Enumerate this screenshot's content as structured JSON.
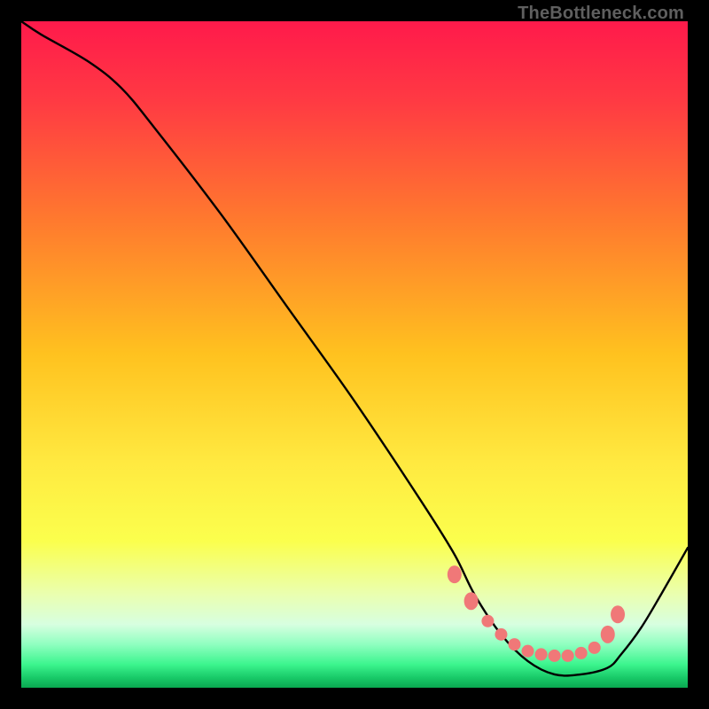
{
  "watermark": "TheBottleneck.com",
  "chart_data": {
    "type": "line",
    "xlim": [
      0,
      100
    ],
    "ylim": [
      0,
      100
    ],
    "xlabel": "",
    "ylabel": "",
    "title": "",
    "grid": false,
    "legend": false,
    "series": [
      {
        "name": "curve",
        "color": "#000000",
        "x": [
          0,
          3,
          10,
          15,
          20,
          30,
          40,
          50,
          60,
          65,
          68,
          72,
          76,
          80,
          84,
          88,
          90,
          93,
          96,
          100
        ],
        "y": [
          100,
          98,
          94,
          90,
          84,
          71,
          57,
          43,
          28,
          20,
          14,
          8,
          4,
          2,
          2,
          3,
          5,
          9,
          14,
          21
        ]
      }
    ],
    "markers": {
      "color": "#f07878",
      "points_xy": [
        [
          65,
          17
        ],
        [
          67.5,
          13
        ],
        [
          70,
          10
        ],
        [
          72,
          8
        ],
        [
          74,
          6.5
        ],
        [
          76,
          5.5
        ],
        [
          78,
          5
        ],
        [
          80,
          4.8
        ],
        [
          82,
          4.8
        ],
        [
          84,
          5.2
        ],
        [
          86,
          6
        ],
        [
          88,
          8
        ],
        [
          89.5,
          11
        ]
      ]
    },
    "background_gradient": {
      "stops": [
        {
          "offset": 0.0,
          "color": "#ff1a4b"
        },
        {
          "offset": 0.12,
          "color": "#ff3a43"
        },
        {
          "offset": 0.3,
          "color": "#ff7a2e"
        },
        {
          "offset": 0.5,
          "color": "#ffc21f"
        },
        {
          "offset": 0.66,
          "color": "#ffe940"
        },
        {
          "offset": 0.78,
          "color": "#fbff4d"
        },
        {
          "offset": 0.86,
          "color": "#eaffb0"
        },
        {
          "offset": 0.905,
          "color": "#d7ffe0"
        },
        {
          "offset": 0.935,
          "color": "#8fffc0"
        },
        {
          "offset": 0.965,
          "color": "#3cf58e"
        },
        {
          "offset": 0.985,
          "color": "#18c968"
        },
        {
          "offset": 1.0,
          "color": "#0aa850"
        }
      ]
    }
  }
}
